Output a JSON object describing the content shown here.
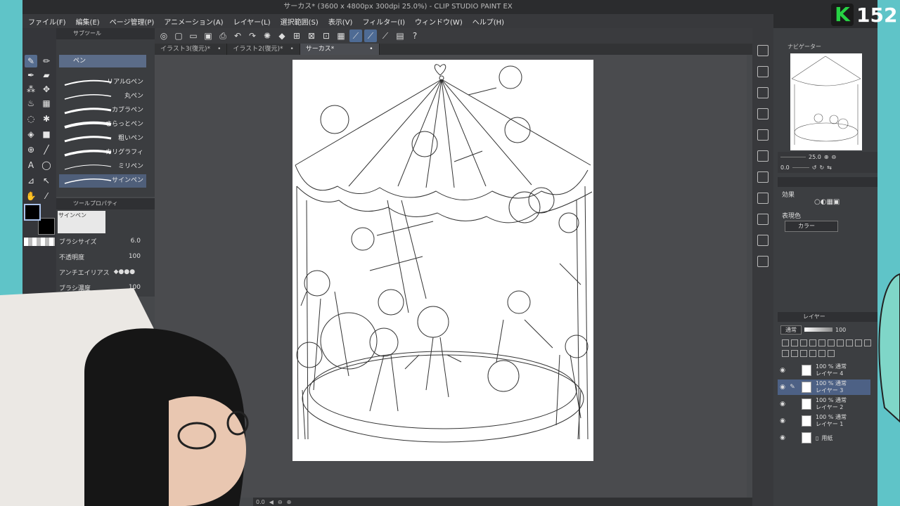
{
  "window": {
    "title": "サーカス* (3600 x 4800px 300dpi 25.0%)  - CLIP STUDIO PAINT EX"
  },
  "menu": [
    "ファイル(F)",
    "編集(E)",
    "ページ管理(P)",
    "アニメーション(A)",
    "レイヤー(L)",
    "選択範囲(S)",
    "表示(V)",
    "フィルター(I)",
    "ウィンドウ(W)",
    "ヘルプ(H)"
  ],
  "tabs": [
    {
      "label": "イラスト3(復元)*"
    },
    {
      "label": "イラスト2(復元)*"
    },
    {
      "label": "サーカス*"
    }
  ],
  "subtool": {
    "header": "サブツール",
    "selected": "ペン",
    "brushes": [
      "リアルGペン",
      "丸ペン",
      "カブラペン",
      "さらっとペン",
      "粗いペン",
      "カリグラフィ",
      "ミリペン",
      "サインペン"
    ]
  },
  "tool_property": {
    "header": "ツールプロパティ",
    "preview_label": "サインペン",
    "brush_size_label": "ブラシサイズ",
    "brush_size_value": "6.0",
    "opacity_label": "不透明度",
    "opacity_value": "100",
    "antialias_label": "アンチエイリアス",
    "density_label": "ブラシ濃度",
    "density_value": "100"
  },
  "navigator": {
    "header": "ナビゲーター",
    "zoom": "25.0",
    "rotation": "0.0"
  },
  "layer_property": {
    "effect_label": "効果",
    "expression_label": "表現色",
    "expression_value": "カラー"
  },
  "layers_panel": {
    "header": "レイヤー",
    "blend_mode": "通常",
    "opacity": "100",
    "layers": [
      {
        "mode": "100 % 通常",
        "name": "レイヤー 4",
        "selected": false
      },
      {
        "mode": "100 % 通常",
        "name": "レイヤー 3",
        "selected": true
      },
      {
        "mode": "100 % 通常",
        "name": "レイヤー 2",
        "selected": false
      },
      {
        "mode": "100 % 通常",
        "name": "レイヤー 1",
        "selected": false
      }
    ],
    "paper_label": "用紙"
  },
  "overlay": {
    "badge": "K",
    "count": "152"
  },
  "colors": {
    "accent": "#566d8f",
    "selected_layer": "#4d6185",
    "background": "#5fc4c8"
  }
}
